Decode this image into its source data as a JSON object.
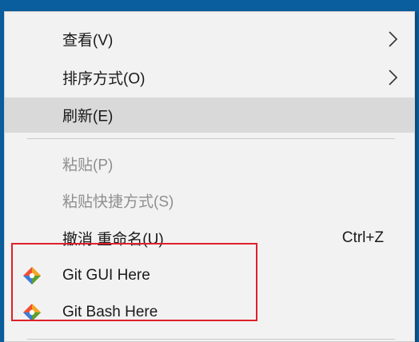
{
  "menu": {
    "view": {
      "label": "查看(V)",
      "icon": "chevron-right-icon"
    },
    "sort": {
      "label": "排序方式(O)",
      "icon": "chevron-right-icon"
    },
    "refresh": {
      "label": "刷新(E)"
    },
    "paste": {
      "label": "粘贴(P)"
    },
    "paste_shortcut": {
      "label": "粘贴快捷方式(S)"
    },
    "undo_rename": {
      "label": "撤消 重命名(U)",
      "shortcut": "Ctrl+Z"
    },
    "git_gui": {
      "label": "Git GUI Here",
      "icon": "git-icon"
    },
    "git_bash": {
      "label": "Git Bash Here",
      "icon": "git-icon"
    }
  },
  "colors": {
    "desktop": "#0b5e9e",
    "menu_bg": "#f2f2f2",
    "hover_bg": "#d9d9d9",
    "disabled_text": "#8f8f8f",
    "highlight_border": "#e0202a"
  }
}
